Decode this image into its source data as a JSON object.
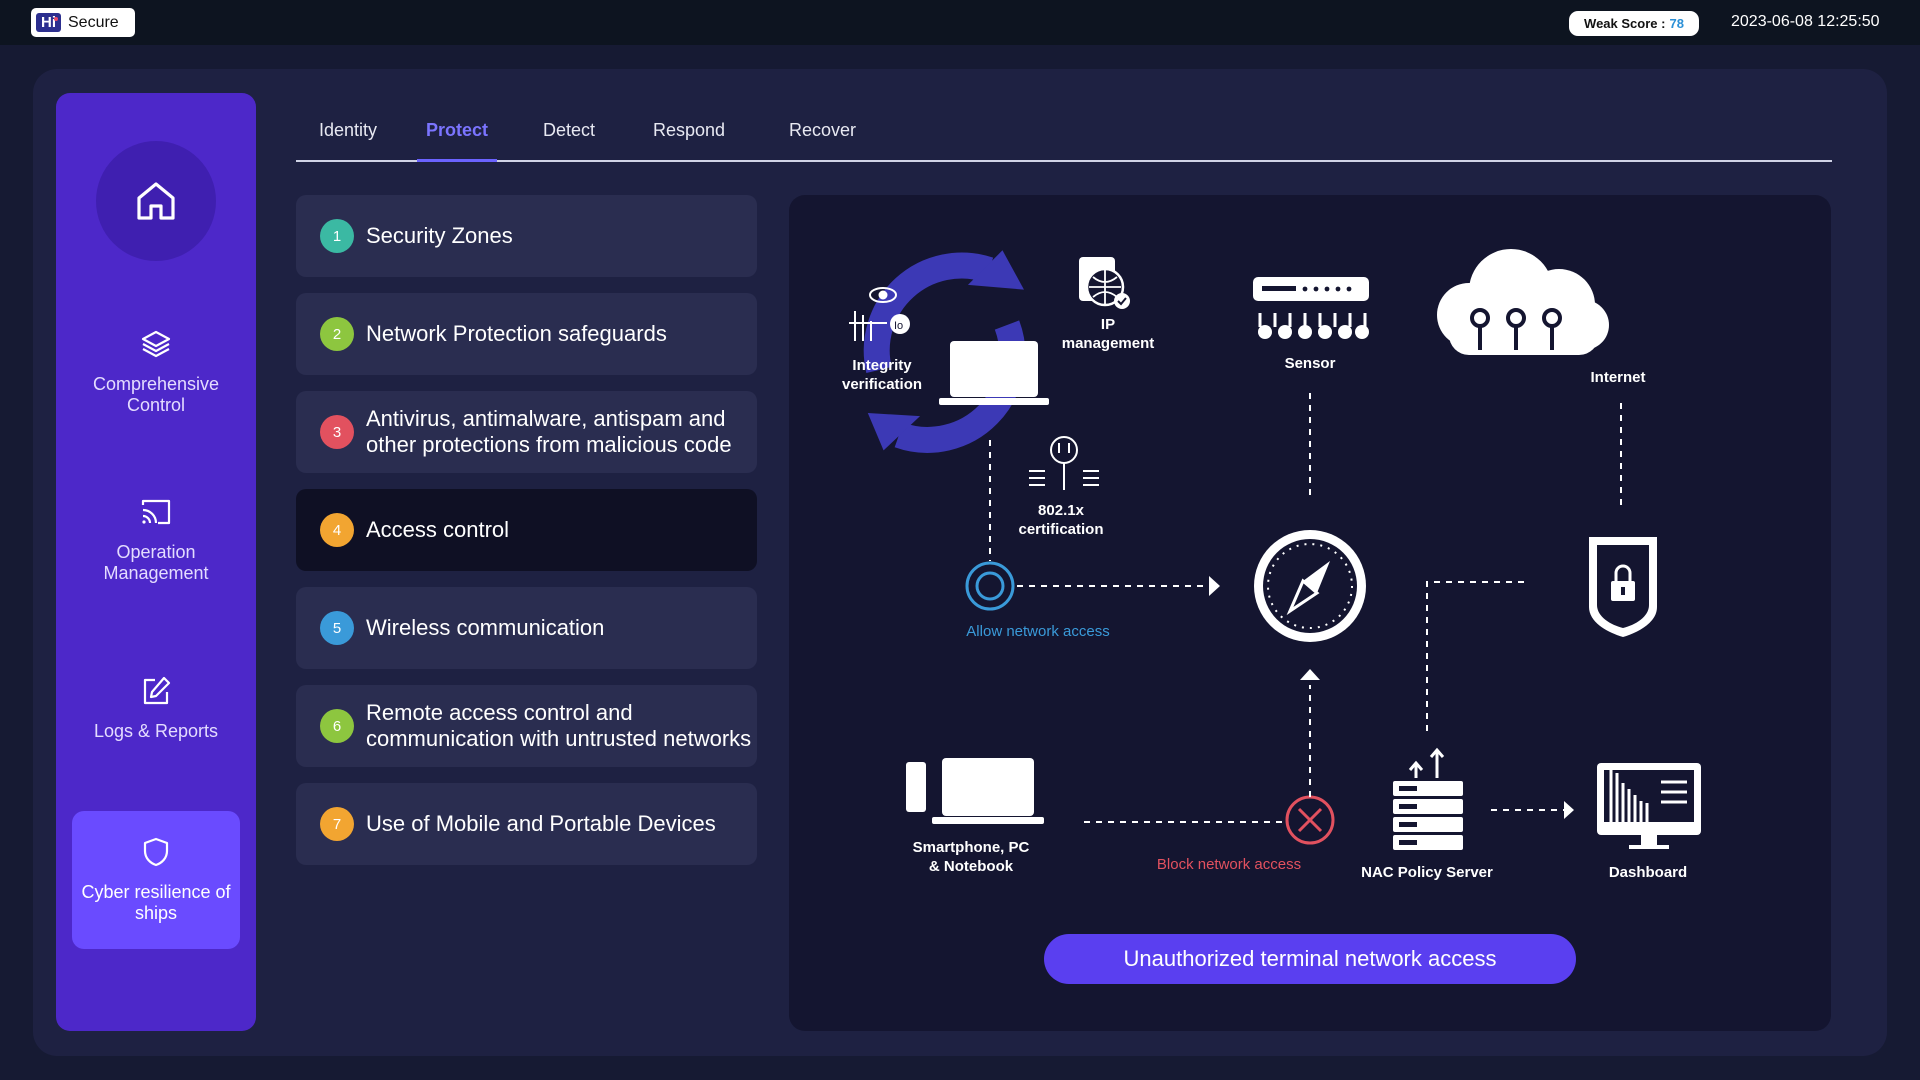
{
  "header": {
    "logo_mark": "Hi",
    "logo_text": "Secure",
    "weak_score_label": "Weak Score :",
    "weak_score_value": "78",
    "datetime": "2023-06-08 12:25:50"
  },
  "sidebar": {
    "home_icon": "home-icon",
    "items": [
      {
        "label": "Comprehensive Control",
        "icon": "layers-icon",
        "active": false
      },
      {
        "label": "Operation Management",
        "icon": "cast-icon",
        "active": false
      },
      {
        "label": "Logs & Reports",
        "icon": "edit-icon",
        "active": false
      },
      {
        "label": "Cyber resilience of ships",
        "icon": "shield-icon",
        "active": true
      }
    ]
  },
  "tabs": [
    {
      "label": "Identity",
      "active": false
    },
    {
      "label": "Protect",
      "active": true
    },
    {
      "label": "Detect",
      "active": false
    },
    {
      "label": "Respond",
      "active": false
    },
    {
      "label": "Recover",
      "active": false
    }
  ],
  "protection_list": [
    {
      "num": "1",
      "label": "Security Zones",
      "color": "#3bb9a3",
      "active": false
    },
    {
      "num": "2",
      "label": "Network Protection safeguards",
      "color": "#8dc63f",
      "active": false
    },
    {
      "num": "3",
      "label": "Antivirus, antimalware, antispam and other protections from malicious code",
      "color": "#e2515f",
      "active": false
    },
    {
      "num": "4",
      "label": "Access control",
      "color": "#f2a531",
      "active": true
    },
    {
      "num": "5",
      "label": "Wireless communication",
      "color": "#3a9ad9",
      "active": false
    },
    {
      "num": "6",
      "label": "Remote access control and communication with untrusted networks",
      "color": "#8dc63f",
      "active": false
    },
    {
      "num": "7",
      "label": "Use of Mobile and Portable Devices",
      "color": "#f2a531",
      "active": false
    }
  ],
  "diagram": {
    "integrity_label": "Integrity verification",
    "ip_label": "IP management",
    "cert_label": "802.1x certification",
    "sensor_label": "Sensor",
    "internet_label": "Internet",
    "allow_label": "Allow network access",
    "block_label": "Block network access",
    "devices_label": "Smartphone, PC & Notebook",
    "nac_label": "NAC Policy Server",
    "dashboard_label": "Dashboard",
    "cta_label": "Unauthorized terminal network access",
    "colors": {
      "allow": "#3a9ad9",
      "block": "#e2515f",
      "cycle": "#3c39b5"
    }
  }
}
